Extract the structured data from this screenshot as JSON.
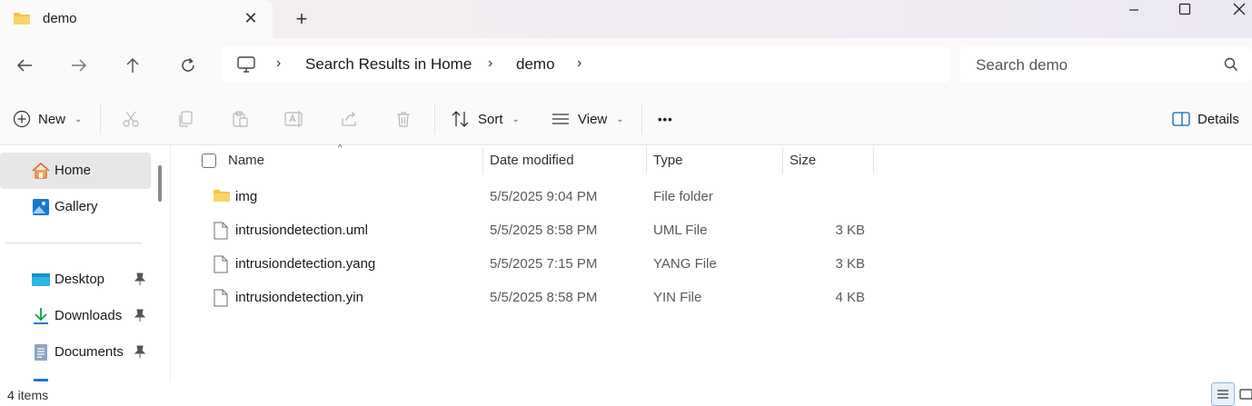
{
  "window": {
    "tab_title": "demo",
    "close_tab_glyph": "✕",
    "new_tab_glyph": "+",
    "minimize_glyph": "—",
    "close_glyph": "✕"
  },
  "address_bar": {
    "breadcrumbs": [
      "Search Results in Home",
      "demo"
    ],
    "separator": "›"
  },
  "search": {
    "placeholder": "Search demo"
  },
  "toolbar": {
    "new_label": "New",
    "sort_label": "Sort",
    "view_label": "View",
    "more_label": "•••",
    "details_label": "Details",
    "chevron": "⌄"
  },
  "sidebar": {
    "items": [
      {
        "label": "Home",
        "icon": "home-icon",
        "active": true
      },
      {
        "label": "Gallery",
        "icon": "gallery-icon",
        "active": false
      },
      {
        "label": "Desktop",
        "icon": "desktop-icon",
        "pinned": true
      },
      {
        "label": "Downloads",
        "icon": "download-icon",
        "pinned": true
      },
      {
        "label": "Documents",
        "icon": "documents-icon",
        "pinned": true
      }
    ],
    "pin_glyph": "📌"
  },
  "columns": {
    "name": "Name",
    "date": "Date modified",
    "type": "Type",
    "size": "Size",
    "sort_caret": "^"
  },
  "files": [
    {
      "name": "img",
      "date": "5/5/2025 9:04 PM",
      "type": "File folder",
      "size": "",
      "icon": "folder-icon"
    },
    {
      "name": "intrusiondetection.uml",
      "date": "5/5/2025 8:58 PM",
      "type": "UML File",
      "size": "3 KB",
      "icon": "file-icon"
    },
    {
      "name": "intrusiondetection.yang",
      "date": "5/5/2025 7:15 PM",
      "type": "YANG File",
      "size": "3 KB",
      "icon": "file-icon"
    },
    {
      "name": "intrusiondetection.yin",
      "date": "5/5/2025 8:58 PM",
      "type": "YIN File",
      "size": "4 KB",
      "icon": "file-icon"
    }
  ],
  "status": {
    "item_count": "4 items"
  },
  "colors": {
    "folder": "#f4c34b",
    "accent": "#0067c0"
  }
}
